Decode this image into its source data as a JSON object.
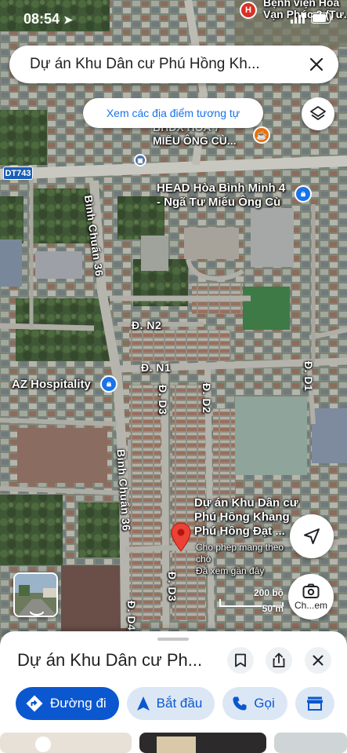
{
  "status_bar": {
    "time": "08:54"
  },
  "search": {
    "query": "Dự án Khu Dân cư Phú Hồng Kh..."
  },
  "chips": {
    "similar_places": "Xem các địa điểm tương tự"
  },
  "map_labels": {
    "hospital_top": "Bệnh viện Hoà",
    "hospital_top_2": "Vạn Phúc 2 (Tư...",
    "temple_line1": "BHDX HOA 7",
    "temple_line2": "MIẾU ÔNG CÙ...",
    "route_shield": "DT743",
    "head_line1": "HEAD Hòa Bình Minh 4",
    "head_line2": "- Ngã Tư Miếu Ông Cù",
    "binh_chuan_top": "Bình Chuẩn 36",
    "binh_chuan_bottom": "Bình Chuẩn 36",
    "road_n2": "Đ. N2",
    "road_n1": "Đ. N1",
    "road_d1": "Đ. D1",
    "road_d2": "Đ. D2",
    "road_d3_top": "Đ. D3",
    "road_d3_bottom": "Đ. D3",
    "road_d4": "Đ. D4",
    "az_hospitality": "AZ Hospitality",
    "pin_line1": "Dự án Khu Dân cư",
    "pin_line2": "Phú Hồng Khang",
    "pin_line3": "Phú Hồng Đạt ...",
    "pin_note1": "Cho phép mang theo",
    "pin_note2": "chó",
    "pin_note3": "Đã xem gần đây"
  },
  "scale": {
    "feet": "200 bộ",
    "meters": "50 m"
  },
  "lens": {
    "label": "Ch...em"
  },
  "sheet": {
    "title": "Dự án Khu Dân cư Ph...",
    "actions": [
      {
        "label": "Đường đi",
        "icon": "directions-icon"
      },
      {
        "label": "Bắt đầu",
        "icon": "navigation-icon"
      },
      {
        "label": "Gọi",
        "icon": "phone-icon"
      }
    ]
  },
  "colors": {
    "accent": "#0b57d0",
    "chip_bg": "#dbe7f4",
    "pin": "#ea4335"
  }
}
